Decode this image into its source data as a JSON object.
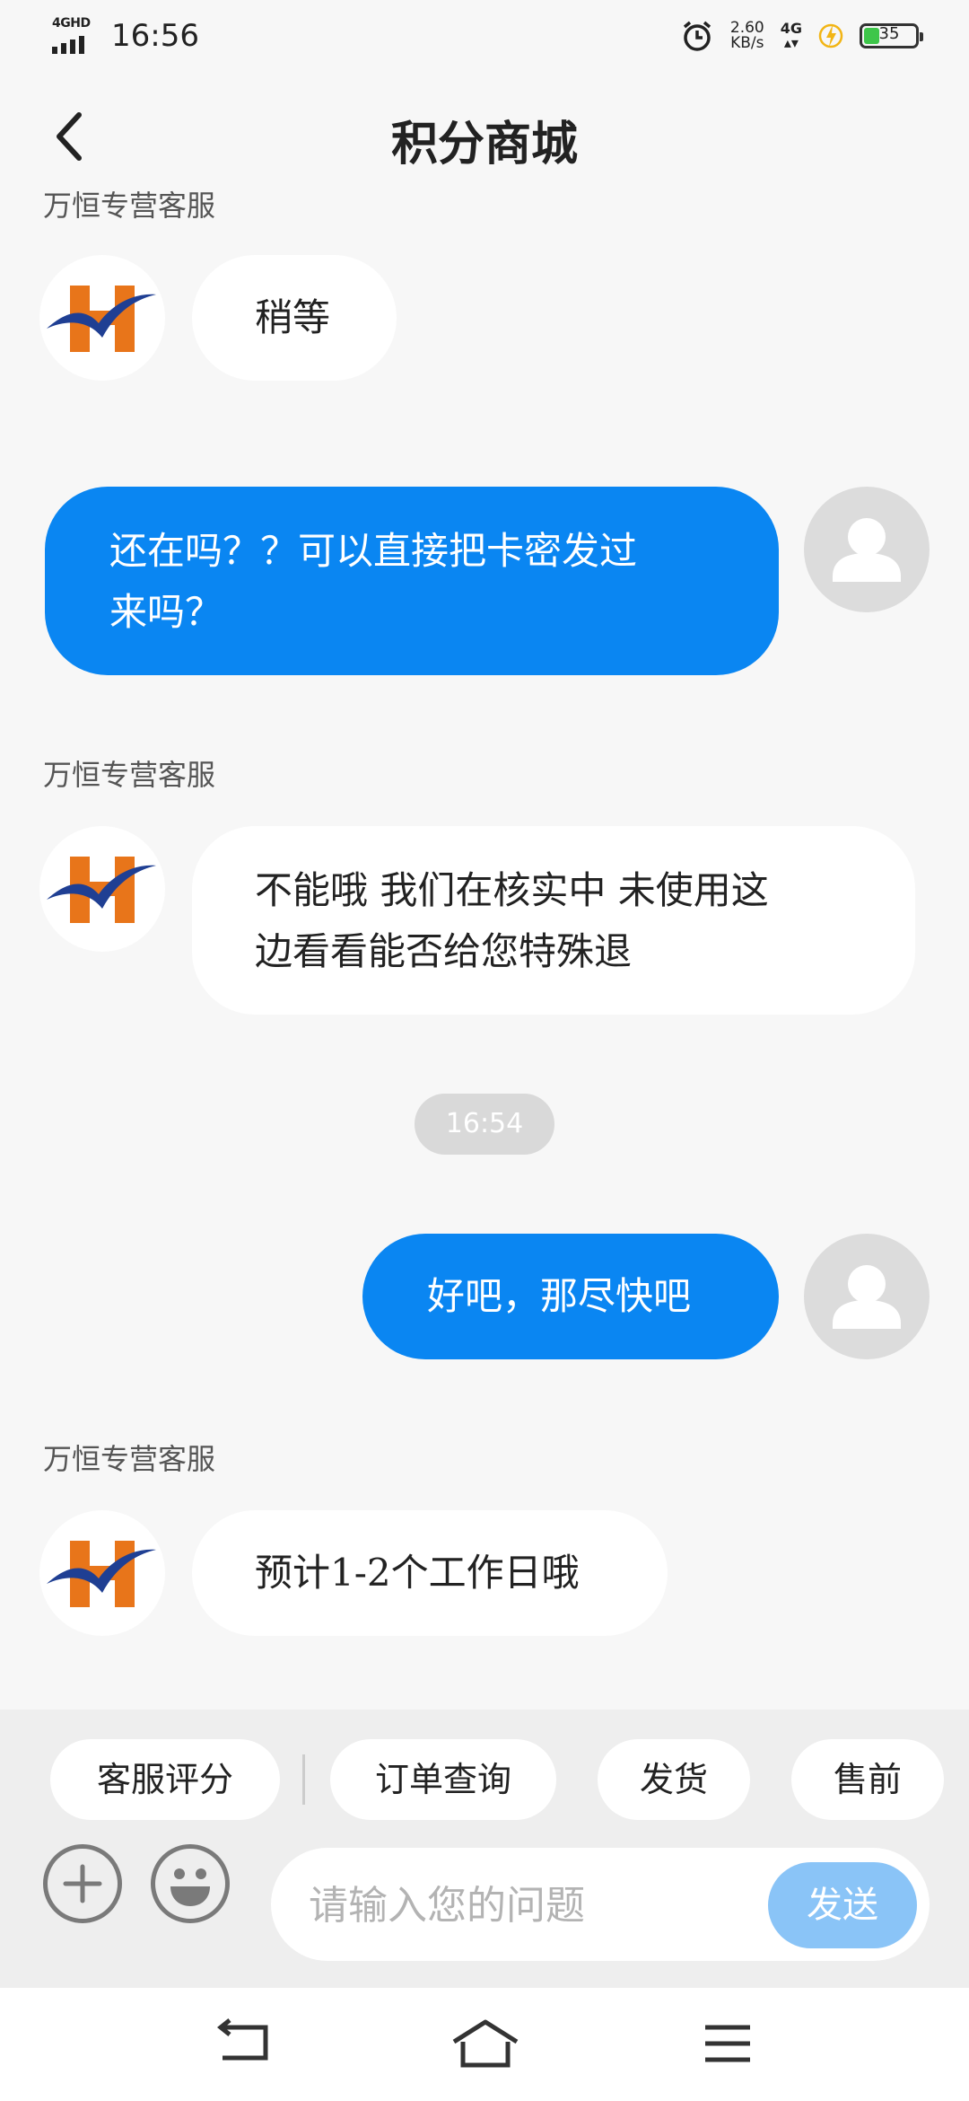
{
  "status_bar": {
    "network_label": "4GHD",
    "time": "16:56",
    "net_speed_value": "2.60",
    "net_speed_unit": "KB/s",
    "mobile_data": "4G",
    "battery_percent": "35",
    "battery_level": 0.35,
    "battery_color": "#3ec64a"
  },
  "header": {
    "title": "积分商城",
    "back_icon": "chevron-left-icon"
  },
  "chat": {
    "agent_name": "万恒专营客服",
    "messages": [
      {
        "from": "agent",
        "sender": "万恒专营客服",
        "lines": [
          "稍等"
        ]
      },
      {
        "from": "user",
        "lines": [
          "还在吗？？可以直接把卡密发过",
          "来吗？"
        ]
      },
      {
        "from": "agent",
        "sender": "万恒专营客服",
        "lines": [
          "不能哦 我们在核实中 未使用这",
          "边看看能否给您特殊退"
        ]
      },
      {
        "from": "system",
        "lines": [
          "16:54"
        ]
      },
      {
        "from": "user",
        "lines": [
          "好吧，那尽快吧"
        ]
      },
      {
        "from": "agent",
        "sender": "万恒专营客服",
        "lines": [
          "预计1-2个工作日哦"
        ]
      }
    ]
  },
  "quick_replies": [
    "客服评分",
    "订单查询",
    "发货",
    "售前"
  ],
  "composer": {
    "placeholder": "请输入您的问题",
    "value": "",
    "send_label": "发送",
    "add_icon": "plus-circle-icon",
    "emoji_icon": "emoji-icon"
  },
  "nav_bar": {
    "icons": [
      "back-nav-icon",
      "home-nav-icon",
      "menu-nav-icon"
    ]
  },
  "colors": {
    "accent": "#0a86f2",
    "send_disabled": "#8ac4f7",
    "logo_orange": "#e8751a",
    "logo_blue": "#1f3f93"
  }
}
